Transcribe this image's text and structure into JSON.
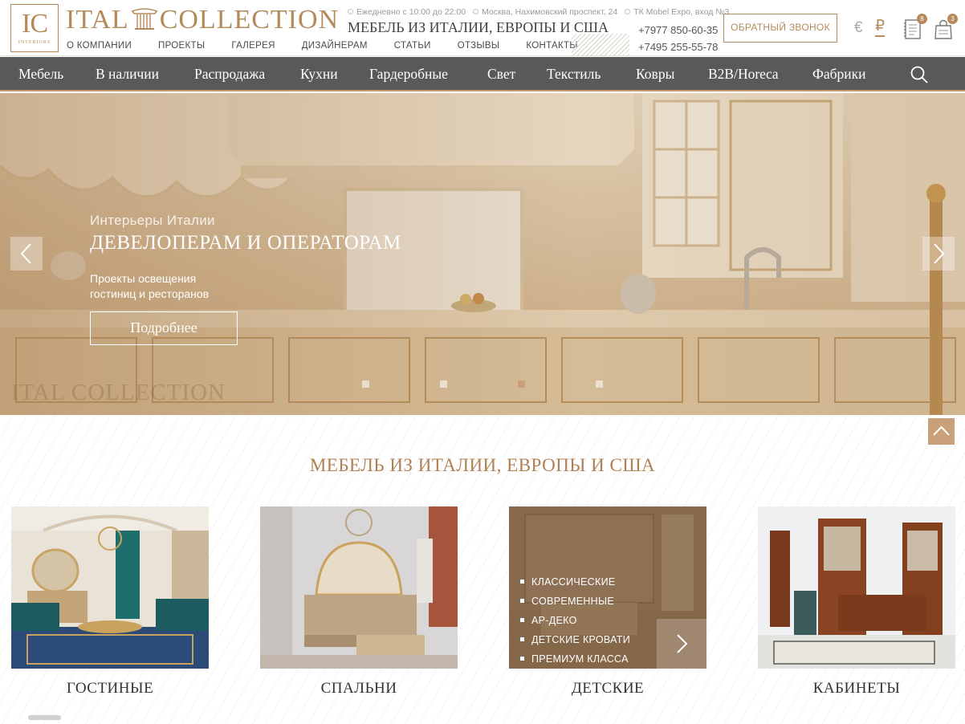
{
  "header": {
    "logo_text": "IC",
    "logo_sub": "INTERIORS",
    "brand_left": "ITAL",
    "brand_right": "COLLECTION",
    "info": [
      "Ежедневно с 10:00 до 22:00",
      "Москва, Нахимовский проспект, 24",
      "ТК Mobel Expo, вход №3"
    ],
    "tagline": "МЕБЕЛЬ ИЗ ИТАЛИИ, ЕВРОПЫ И США",
    "phones": [
      "+7977 850-60-35",
      "+7495 255-55-78"
    ],
    "callback_label": "ОБРАТНЫЙ ЗВОНОК",
    "currency_eur": "€",
    "currency_rub": "₽",
    "wishlist_count": "8",
    "cart_count": "3",
    "top_nav": [
      "О КОМПАНИИ",
      "ПРОЕКТЫ",
      "ГАЛЕРЕЯ",
      "ДИЗАЙНЕРАМ",
      "СТАТЬИ",
      "ОТЗЫВЫ",
      "КОНТАКТЫ"
    ]
  },
  "menu": [
    "Мебель",
    "В наличии",
    "Распродажа",
    "Кухни",
    "Гардеробные",
    "Свет",
    "Текстиль",
    "Ковры",
    "B2B/Horeca",
    "Фабрики"
  ],
  "hero": {
    "subtitle": "Интерьеры Италии",
    "title": "ДЕВЕЛОПЕРАМ И ОПЕРАТОРАМ",
    "desc_line1": "Проекты освещения",
    "desc_line2": "гостиниц и ресторанов",
    "button": "Подробнее",
    "watermark": "ITAL COLLECTION",
    "slide_count": 4,
    "active_slide": 3
  },
  "section": {
    "title": "МЕБЕЛЬ ИЗ ИТАЛИИ, ЕВРОПЫ И США",
    "categories": [
      "ГОСТИНЫЕ",
      "СПАЛЬНИ",
      "ДЕТСКИЕ",
      "КАБИНЕТЫ"
    ],
    "kids_styles": [
      "КЛАССИЧЕСКИЕ",
      "СОВРЕМЕННЫЕ",
      "АР-ДЕКО",
      "ДЕТСКИЕ КРОВАТИ",
      "ПРЕМИУМ КЛАССА"
    ]
  },
  "colors": {
    "accent": "#b58a5a",
    "menu_bg": "#595959"
  }
}
